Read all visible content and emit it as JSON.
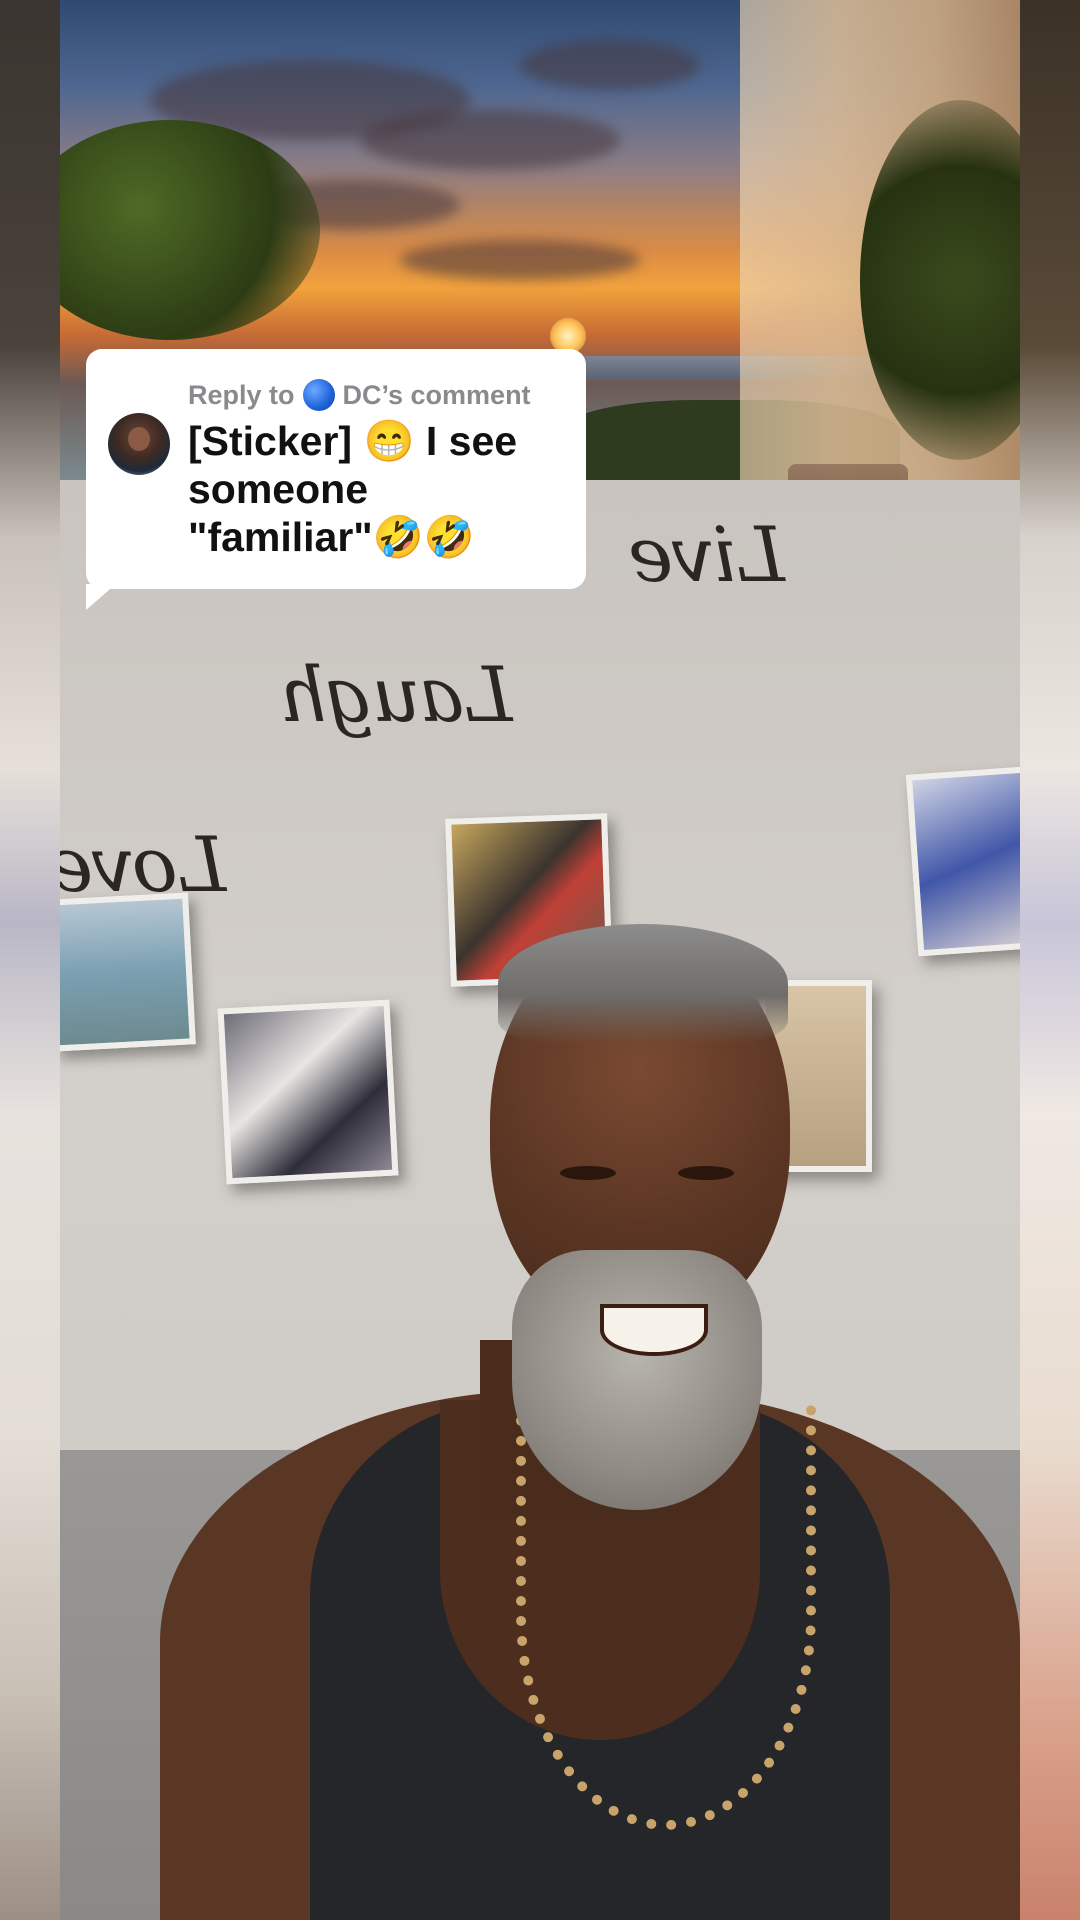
{
  "reply_sticker": {
    "reply_prefix": "Reply to",
    "commenter_name": "DC’s comment",
    "commenter_badge_icon": "blue-circle-icon",
    "comment_text": "[Sticker] 😁 I see someone \"familiar\"🤣🤣"
  },
  "background_wall_words": {
    "word_1": "Laugh",
    "word_2": "Love",
    "word_3": "Live"
  },
  "colors": {
    "card_background": "#ffffff",
    "header_text": "#8a8a8e",
    "comment_text": "#111111",
    "badge_blue": "#1d63d8"
  }
}
